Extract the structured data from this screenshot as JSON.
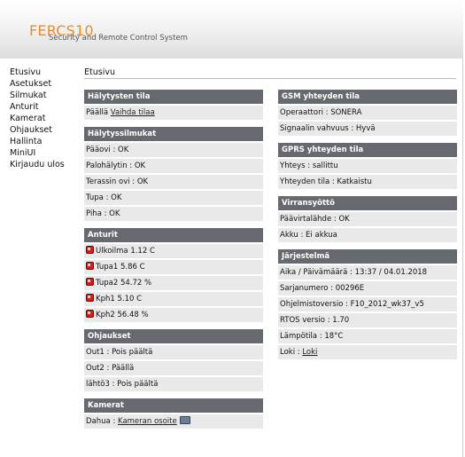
{
  "header": {
    "brand": "FERCS10",
    "tagline": "Security and Remote Control System"
  },
  "nav": {
    "items": [
      "Etusivu",
      "Asetukset",
      "Silmukat",
      "Anturit",
      "Kamerat",
      "Ohjaukset",
      "Hallinta",
      "MiniUI",
      "Kirjaudu ulos"
    ]
  },
  "page": {
    "breadcrumb": "Etusivu"
  },
  "left": {
    "alarm_state": {
      "title": "Hälytysten tila",
      "status": "Päällä",
      "action_link": "Vaihda tilaa"
    },
    "loops": {
      "title": "Hälytyssilmukat",
      "rows": [
        "Pääovi : OK",
        "Palohälytin : OK",
        "Terassin ovi : OK",
        "Tupa : OK",
        "Piha : OK"
      ]
    },
    "sensors": {
      "title": "Anturit",
      "rows": [
        "Ulkoilma 1.12 C",
        "Tupa1 5.86 C",
        "Tupa2 54.72 %",
        "Kph1 5.10 C",
        "Kph2 56.48 %"
      ]
    },
    "controls": {
      "title": "Ohjaukset",
      "rows": [
        "Out1 : Pois päältä",
        "Out2 : Päällä",
        "lähtö3 : Pois päältä"
      ]
    },
    "cameras": {
      "title": "Kamerat",
      "label": "Dahua : ",
      "link": "Kameran osoite"
    }
  },
  "right": {
    "gsm": {
      "title": "GSM yhteyden tila",
      "rows": [
        "Operaattori : SONERA",
        "Signaalin vahvuus : Hyvä"
      ]
    },
    "gprs": {
      "title": "GPRS yhteyden tila",
      "rows": [
        "Yhteys : sallittu",
        "Yhteyden tila : Katkaistu"
      ]
    },
    "power": {
      "title": "Virransyöttö",
      "rows": [
        "Päävirtalähde : OK",
        "Akku : Ei akkua"
      ]
    },
    "system": {
      "title": "Järjestelmä",
      "rows": [
        "Aika / Päivämäärä : 13:37 / 04.01.2018",
        "Sarjanumero : 00296E",
        "Ohjelmistoversio : F10_2012_wk37_v5",
        "RTOS versio : 1.70",
        "Lämpötila : 18°C"
      ],
      "log_label": "Loki : ",
      "log_link": "Loki"
    }
  }
}
